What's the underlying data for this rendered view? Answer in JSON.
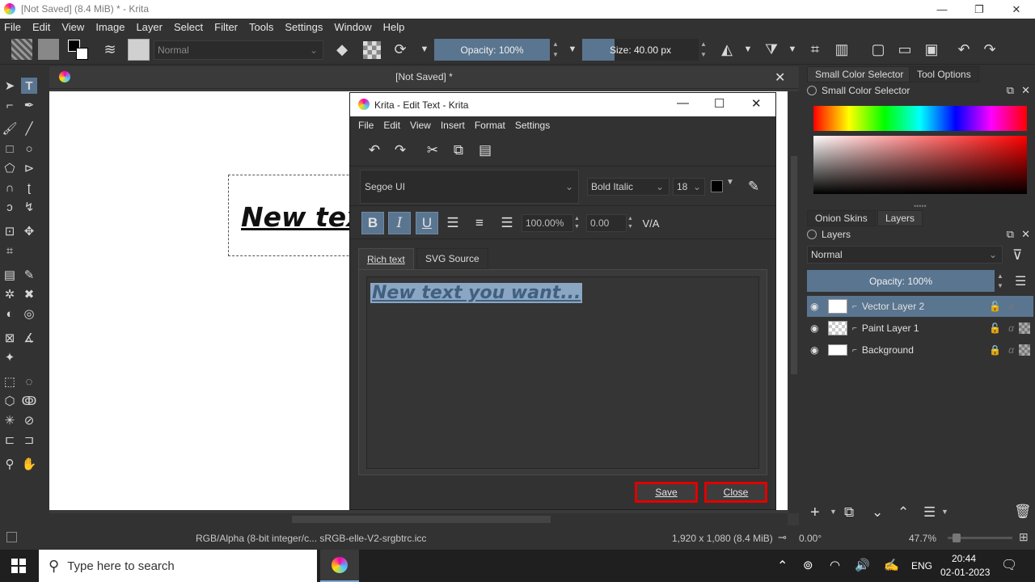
{
  "window": {
    "title": "[Not Saved]  (8.4 MiB)  * - Krita",
    "minimize": "—",
    "restore": "❐",
    "close": "✕"
  },
  "menu": [
    "File",
    "Edit",
    "View",
    "Image",
    "Layer",
    "Select",
    "Filter",
    "Tools",
    "Settings",
    "Window",
    "Help"
  ],
  "toolbar": {
    "blend_mode": "Normal",
    "opacity": "Opacity: 100%",
    "opacity_level": 1.0,
    "size": "Size: 40.00 px",
    "size_level": 0.28
  },
  "document": {
    "tab_title": "[Not Saved]  *",
    "canvas_text": "New tex"
  },
  "dialog": {
    "title": "Krita - Edit Text - Krita",
    "menu": [
      "File",
      "Edit",
      "View",
      "Insert",
      "Format",
      "Settings"
    ],
    "font": "Segoe UI",
    "style": "Bold Italic",
    "size": "18",
    "color": "#000000",
    "line_height": "100.00%",
    "letter_spacing": "0.00",
    "tabs": [
      "Rich text",
      "SVG Source"
    ],
    "editor_text": "New text you want...",
    "save_label": "Save",
    "close_label": "Close"
  },
  "right_dock": {
    "tabs_top": [
      "Small Color Selector",
      "Tool Options"
    ],
    "color_panel_title": "Small Color Selector",
    "tabs_mid": [
      "Onion Skins",
      "Layers"
    ],
    "layers_panel_title": "Layers",
    "blend_mode": "Normal",
    "opacity": "Opacity:  100%",
    "layers": [
      {
        "name": "Vector Layer 2",
        "selected": true
      },
      {
        "name": "Paint Layer 1",
        "selected": false
      },
      {
        "name": "Background",
        "selected": false
      }
    ]
  },
  "status": {
    "color_space": "RGB/Alpha (8-bit integer/c...  sRGB-elle-V2-srgbtrc.icc",
    "dimensions": "1,920 x 1,080 (8.4 MiB)",
    "rotation": "0.00°",
    "zoom": "47.7%"
  },
  "taskbar": {
    "search_placeholder": "Type here to search",
    "lang": "ENG",
    "time": "20:44",
    "date": "02-01-2023"
  },
  "colors": {
    "accent": "#5a7590",
    "highlight_border": "#e00000",
    "background": "#323232"
  }
}
